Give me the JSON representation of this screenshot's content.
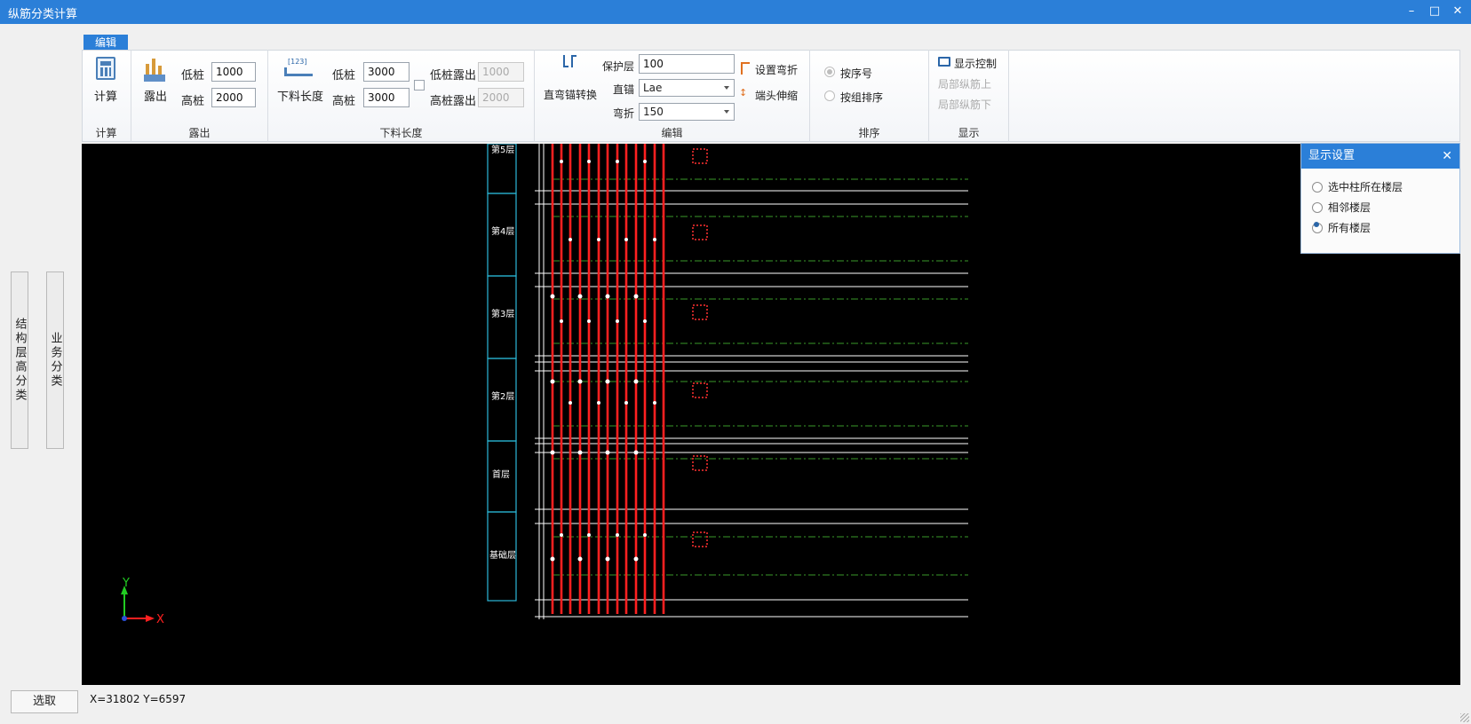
{
  "window": {
    "title": "纵筋分类计算",
    "controls": [
      "minimize-icon",
      "maximize-icon",
      "close-icon"
    ]
  },
  "left_panel": {
    "buttons": [
      "结构层高分类",
      "业务分类"
    ],
    "select_button": "选取"
  },
  "ribbon": {
    "tab": "编辑",
    "groups": {
      "calc": {
        "label": "计算",
        "button": "计算"
      },
      "exposure": {
        "label": "露出",
        "button": "露出",
        "low_label": "低桩",
        "low_value": "1000",
        "high_label": "高桩",
        "high_value": "2000"
      },
      "cut_length": {
        "label": "下料长度",
        "button": "下料长度",
        "icon_text": "[123]",
        "low_label": "低桩",
        "low_value": "3000",
        "high_label": "高桩",
        "high_value": "3000",
        "low_exposed_label": "低桩露出",
        "low_exposed_value": "1000",
        "high_exposed_label": "高桩露出",
        "high_exposed_value": "2000"
      },
      "edit": {
        "label": "编辑",
        "convert_button": "直弯锚转换",
        "cover_label": "保护层",
        "cover_value": "100",
        "straight_label": "直锚",
        "straight_value": "Lae",
        "bend_label": "弯折",
        "bend_value": "150",
        "set_bend": "设置弯折",
        "end_stretch": "端头伸缩"
      },
      "sort": {
        "label": "排序",
        "by_order": "按序号",
        "by_group": "按组排序",
        "selected": "按序号"
      },
      "display": {
        "label": "显示",
        "display_control": "显示控制",
        "local_up": "局部纵筋上",
        "local_down": "局部纵筋下"
      }
    }
  },
  "display_settings": {
    "title": "显示设置",
    "options": [
      "选中柱所在楼层",
      "相邻楼层",
      "所有楼层"
    ],
    "selected": "所有楼层"
  },
  "canvas": {
    "floor_labels": [
      "第5层",
      "第4层",
      "第3层",
      "第2层",
      "首层",
      "基础层"
    ],
    "axis_x": "X",
    "axis_y": "Y"
  },
  "status": {
    "coords": "X=31802 Y=6597"
  },
  "colors": {
    "accent": "#2b7fd8",
    "rebar": "#ff2020",
    "guide": "#3a9a2a",
    "floor_box": "#2bb8d8"
  }
}
